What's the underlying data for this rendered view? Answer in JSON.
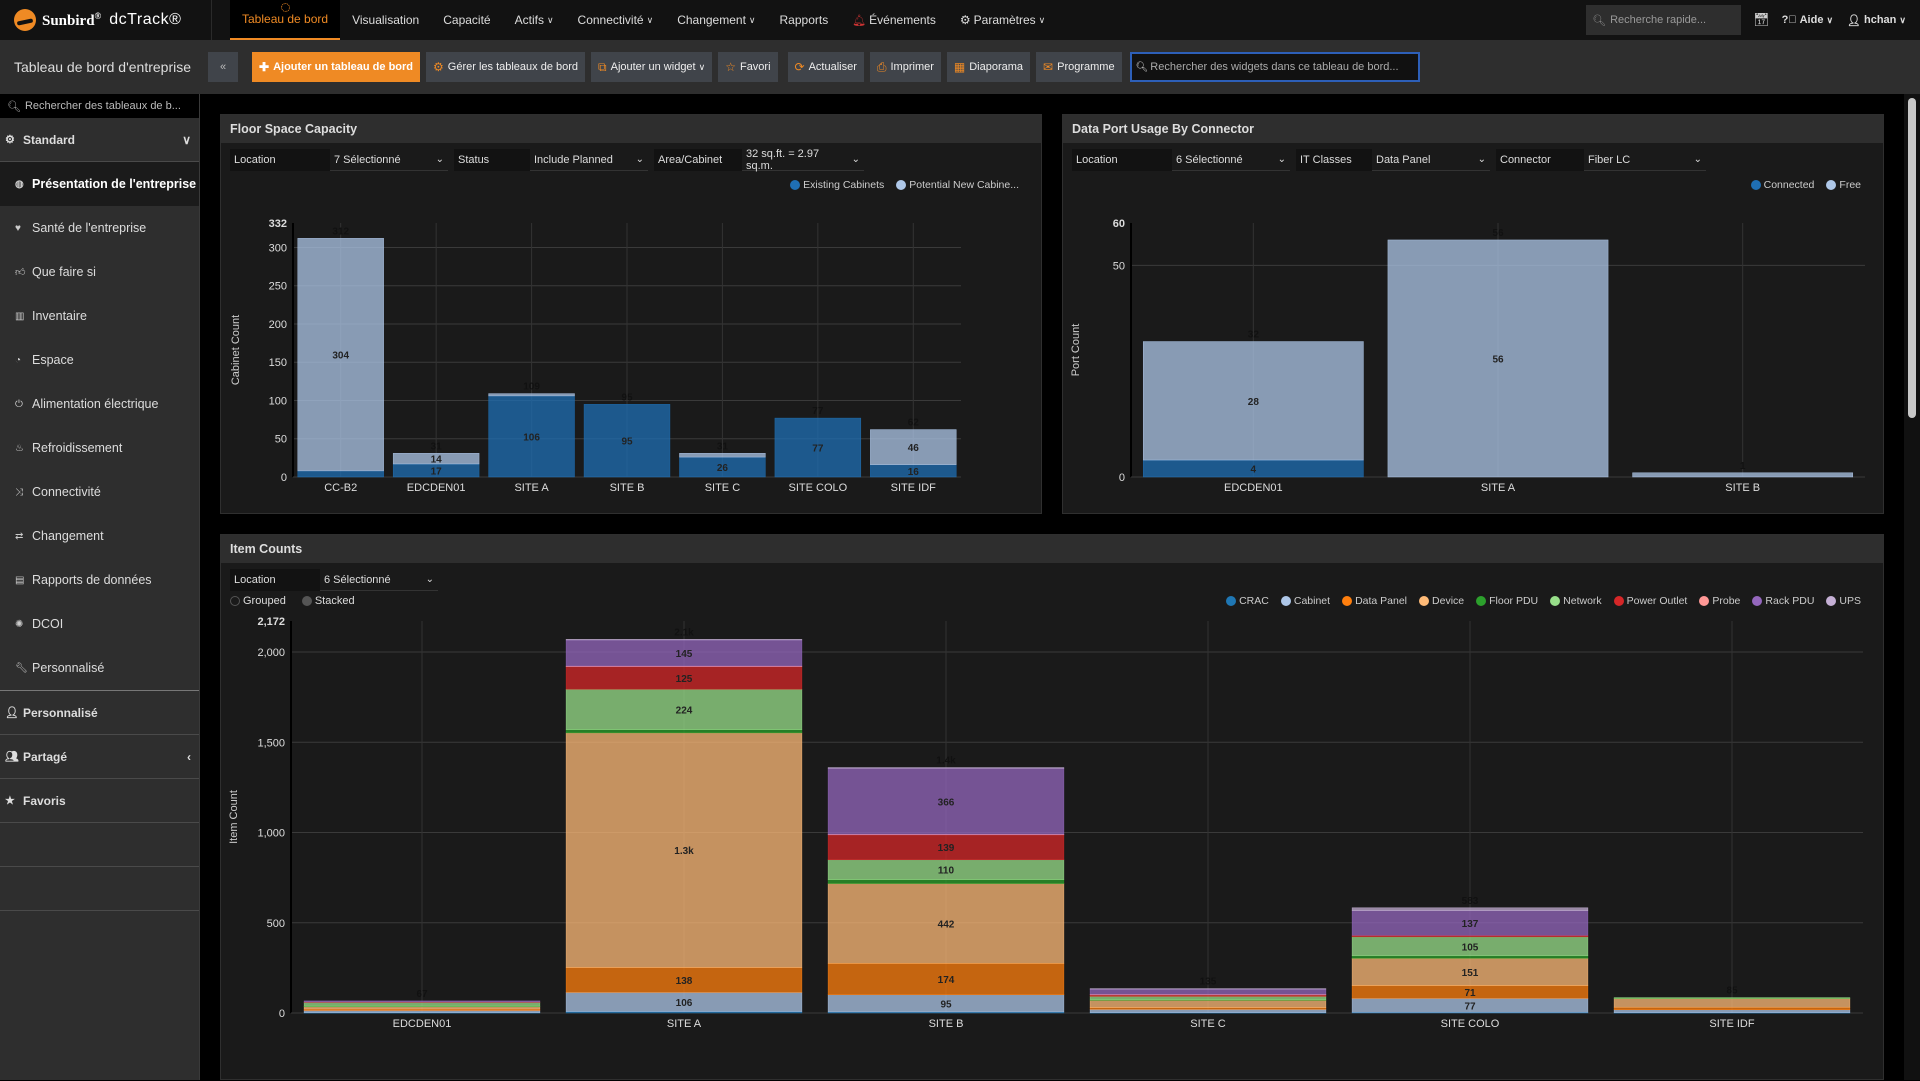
{
  "topnav": {
    "brand_name": "Sunbird",
    "brand_reg": "®",
    "product": "dcTrack®",
    "tabs": [
      {
        "label": "Tableau de bord",
        "active": true,
        "dropdown": false
      },
      {
        "label": "Visualisation",
        "dropdown": false
      },
      {
        "label": "Capacité",
        "dropdown": false
      },
      {
        "label": "Actifs",
        "dropdown": true
      },
      {
        "label": "Connectivité",
        "dropdown": true
      },
      {
        "label": "Changement",
        "dropdown": true
      },
      {
        "label": "Rapports",
        "dropdown": false
      },
      {
        "label": "Événements",
        "dropdown": false,
        "icon": "bell-icon"
      },
      {
        "label": "Paramètres",
        "dropdown": true,
        "icon": "gear-icon"
      }
    ],
    "quick_search_placeholder": "Recherche rapide...",
    "help_label": "Aide",
    "user_label": "hchan"
  },
  "toolbar": {
    "dashboard_title": "Tableau de bord d'entreprise",
    "collapse_icon": "«",
    "add_dashboard": "Ajouter un tableau de bord",
    "manage_dashboards": "Gérer les tableaux de bord",
    "add_widget": "Ajouter un widget",
    "favorite": "Favori",
    "refresh": "Actualiser",
    "print": "Imprimer",
    "slideshow": "Diaporama",
    "schedule": "Programme",
    "widget_search_placeholder": "Rechercher des widgets dans ce tableau de bord..."
  },
  "sidebar": {
    "search_placeholder": "Rechercher des tableaux de b...",
    "standard_label": "Standard",
    "items": [
      {
        "label": "Présentation de l'entreprise",
        "icon": "globe-icon",
        "active": true
      },
      {
        "label": "Santé de l'entreprise",
        "icon": "heartbeat-icon"
      },
      {
        "label": "Que faire si",
        "icon": "thumbs-up-icon"
      },
      {
        "label": "Inventaire",
        "icon": "barcode-icon"
      },
      {
        "label": "Espace",
        "icon": "dashboard-gauge-icon"
      },
      {
        "label": "Alimentation électrique",
        "icon": "power-icon"
      },
      {
        "label": "Refroidissement",
        "icon": "fire-icon"
      },
      {
        "label": "Connectivité",
        "icon": "random-icon"
      },
      {
        "label": "Changement",
        "icon": "exchange-icon"
      },
      {
        "label": "Rapports de données",
        "icon": "table-list-icon"
      },
      {
        "label": "DCOI",
        "icon": "certificate-icon"
      },
      {
        "label": "Personnalisé",
        "icon": "wrench-icon"
      }
    ],
    "sections": [
      {
        "label": "Personnalisé",
        "icon": "user-icon"
      },
      {
        "label": "Partagé",
        "icon": "users-icon"
      },
      {
        "label": "Favoris",
        "icon": "star-icon"
      }
    ]
  },
  "widgets": {
    "floor_space": {
      "title": "Floor Space Capacity",
      "filters": [
        {
          "label": "Location",
          "value": "7 Sélectionné"
        },
        {
          "label": "Status",
          "value": "Include Planned"
        },
        {
          "label": "Area/Cabinet",
          "value": "32 sq.ft. = 2.97 sq.m."
        }
      ]
    },
    "data_port": {
      "title": "Data Port Usage By Connector",
      "filters": [
        {
          "label": "Location",
          "value": "6 Sélectionné"
        },
        {
          "label": "IT Classes",
          "value": "Data Panel"
        },
        {
          "label": "Connector",
          "value": "Fiber LC"
        }
      ]
    },
    "item_counts": {
      "title": "Item Counts",
      "filters": [
        {
          "label": "Location",
          "value": "6 Sélectionné"
        }
      ],
      "mode_options": [
        {
          "label": "Grouped",
          "selected": false
        },
        {
          "label": "Stacked",
          "selected": true
        }
      ]
    }
  },
  "chart_data": [
    {
      "id": "floor_space",
      "type": "bar",
      "stacked": true,
      "title": "Floor Space Capacity",
      "xlabel": "",
      "ylabel": "Cabinet Count",
      "ylim": [
        0,
        332
      ],
      "yticks": [
        0,
        50,
        100,
        150,
        200,
        250,
        300,
        332
      ],
      "ytick_labels": [
        "0",
        "50",
        "100",
        "150",
        "200",
        "250",
        "300",
        "332"
      ],
      "grid": true,
      "legend": "top-right",
      "categories": [
        "CC-B2",
        "EDCDEN01",
        "SITE A",
        "SITE B",
        "SITE C",
        "SITE COLO",
        "SITE IDF"
      ],
      "series": [
        {
          "name": "Existing Cabinets",
          "color": "#1f6fb4",
          "values": [
            8,
            17,
            106,
            95,
            26,
            77,
            16
          ],
          "labels": [
            "",
            "17",
            "106",
            "95",
            "26",
            "77",
            "16"
          ]
        },
        {
          "name": "Potential New Cabine...",
          "color": "#aec7e8",
          "values": [
            304,
            14,
            3,
            0,
            5,
            0,
            46
          ],
          "labels": [
            "304",
            "14",
            "",
            "",
            "",
            "",
            "46"
          ]
        }
      ],
      "totals": [
        "312",
        "31",
        "109",
        "95",
        "31",
        "77",
        "62"
      ]
    },
    {
      "id": "data_port",
      "type": "bar",
      "stacked": true,
      "title": "Data Port Usage By Connector",
      "xlabel": "",
      "ylabel": "Port Count",
      "ylim": [
        0,
        60
      ],
      "yticks": [
        0,
        50,
        60
      ],
      "ytick_labels": [
        "0",
        "50",
        "60"
      ],
      "grid": true,
      "legend": "top-right",
      "categories": [
        "EDCDEN01",
        "SITE A",
        "SITE B"
      ],
      "series": [
        {
          "name": "Connected",
          "color": "#1f6fb4",
          "values": [
            4,
            0,
            0
          ],
          "labels": [
            "4",
            "",
            ""
          ]
        },
        {
          "name": "Free",
          "color": "#aec7e8",
          "values": [
            28,
            56,
            1
          ],
          "labels": [
            "28",
            "56",
            ""
          ]
        }
      ],
      "totals": [
        "32",
        "56",
        "1"
      ]
    },
    {
      "id": "item_counts",
      "type": "bar",
      "stacked": true,
      "title": "Item Counts",
      "xlabel": "",
      "ylabel": "Item Count",
      "ylim": [
        0,
        2172
      ],
      "yticks": [
        0,
        500,
        1000,
        1500,
        2000,
        2172
      ],
      "ytick_labels": [
        "0",
        "500",
        "1,000",
        "1,500",
        "2,000",
        "2,172"
      ],
      "grid": true,
      "legend": "top-right",
      "categories": [
        "EDCDEN01",
        "SITE A",
        "SITE B",
        "SITE C",
        "SITE COLO",
        "SITE IDF"
      ],
      "series": [
        {
          "name": "CRAC",
          "color": "#1f77b4",
          "values": [
            2,
            8,
            6,
            2,
            4,
            2
          ],
          "labels": [
            "",
            "",
            "",
            "",
            "",
            ""
          ]
        },
        {
          "name": "Cabinet",
          "color": "#aec7e8",
          "values": [
            12,
            106,
            95,
            18,
            77,
            16
          ],
          "labels": [
            "",
            "106",
            "95",
            "",
            "77",
            ""
          ]
        },
        {
          "name": "Data Panel",
          "color": "#ff7f0e",
          "values": [
            8,
            138,
            174,
            10,
            71,
            14
          ],
          "labels": [
            "",
            "138",
            "174",
            "",
            "71",
            ""
          ]
        },
        {
          "name": "Device",
          "color": "#ffbb78",
          "values": [
            14,
            1300,
            442,
            40,
            151,
            48
          ],
          "labels": [
            "",
            "1.3k",
            "442",
            "",
            "151",
            ""
          ]
        },
        {
          "name": "Floor PDU",
          "color": "#2ca02c",
          "values": [
            2,
            18,
            22,
            4,
            14,
            3
          ],
          "labels": [
            "",
            "",
            "",
            "",
            "",
            ""
          ]
        },
        {
          "name": "Network",
          "color": "#98df8a",
          "values": [
            21,
            224,
            110,
            18,
            105,
            2
          ],
          "labels": [
            "",
            "224",
            "110",
            "",
            "105",
            ""
          ]
        },
        {
          "name": "Power Outlet",
          "color": "#d62728",
          "values": [
            2,
            125,
            139,
            8,
            8,
            0
          ],
          "labels": [
            "",
            "125",
            "139",
            "",
            "",
            ""
          ]
        },
        {
          "name": "Probe",
          "color": "#ff9896",
          "values": [
            0,
            3,
            2,
            3,
            0,
            0
          ],
          "labels": [
            "",
            "",
            "",
            "",
            "",
            ""
          ]
        },
        {
          "name": "Rack PDU",
          "color": "#9467bd",
          "values": [
            6,
            145,
            366,
            30,
            137,
            0
          ],
          "labels": [
            "",
            "145",
            "366",
            "",
            "137",
            ""
          ]
        },
        {
          "name": "UPS",
          "color": "#c5b0d5",
          "values": [
            0,
            3,
            4,
            2,
            16,
            0
          ],
          "labels": [
            "",
            "",
            "",
            "",
            "",
            ""
          ]
        }
      ],
      "totals": [
        "67",
        "2.1k",
        "1.4k",
        "135",
        "583",
        "85"
      ]
    }
  ]
}
